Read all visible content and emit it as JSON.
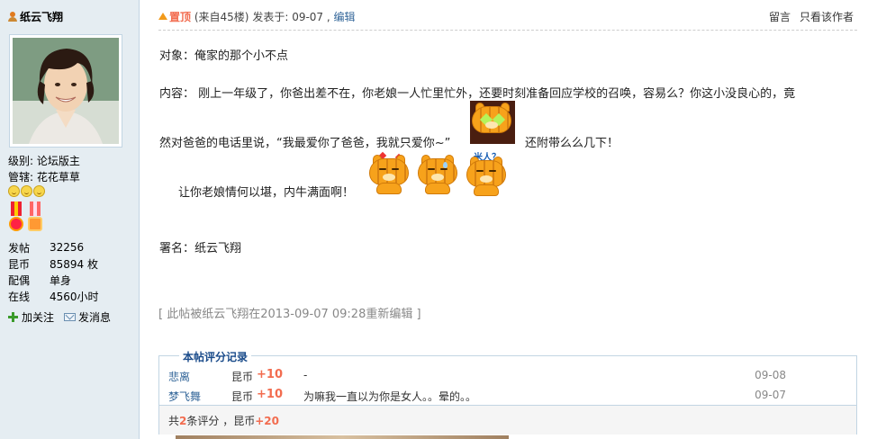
{
  "user": {
    "name": "纸云飞翔",
    "level": "级别: 论坛版主",
    "manage": "管辖: 花花草草",
    "stats": [
      {
        "key": "发帖",
        "value": "32256"
      },
      {
        "key": "昆币",
        "value": "85894 枚"
      },
      {
        "key": "配偶",
        "value": "单身"
      },
      {
        "key": "在线",
        "value": "4560小时"
      }
    ],
    "follow_label": "加关注",
    "message_label": "发消息"
  },
  "post": {
    "top_label": "置顶",
    "floor_info": "(来自45楼)",
    "posted_label": "发表于:",
    "posted_date": "09-07",
    "sep": ",",
    "edit_label": "编辑",
    "reply_label": "留言",
    "author_only_label": "只看该作者",
    "line_target": "对象：俺家的那个小不点",
    "line_content_1": "内容：  刚上一年级了，你爸出差不在，你老娘一人忙里忙外，还要时刻准备回应学校的召唤，容易么？你这小没良心的，竟",
    "line_content_2a": "然对爸爸的电话里说，“我最爱你了爸爸，我就只爱你~”",
    "line_content_2b": "还附带么么几下！",
    "line_content_3": "让你老娘情何以堪，内牛满面啊！",
    "emoticon_caption": "米人？",
    "line_sign": "署名：纸云飞翔",
    "edit_note": "[ 此帖被纸云飞翔在2013-09-07 09:28重新编辑 ]"
  },
  "rating": {
    "title": "本帖评分记录",
    "rows": [
      {
        "user": "悲离",
        "currency": "昆币",
        "amount": "+10",
        "reason": "-",
        "date": "09-08"
      },
      {
        "user": "梦飞舞",
        "currency": "昆币",
        "amount": "+10",
        "reason": "为嘛我一直以为你是女人。。晕的。。",
        "date": "09-07"
      }
    ],
    "summary_prefix": "共",
    "summary_count": "2",
    "summary_mid": "条评分 ，昆币",
    "summary_total": "+20"
  },
  "colors": {
    "accent": "#f26c4f",
    "link": "#336699",
    "sidebar_bg": "#e5edf2",
    "border": "#c2d5e3"
  },
  "icons": [
    "user-icon",
    "up-arrow-icon",
    "plus-icon",
    "mail-icon",
    "smiley-icon",
    "medal-icon"
  ]
}
